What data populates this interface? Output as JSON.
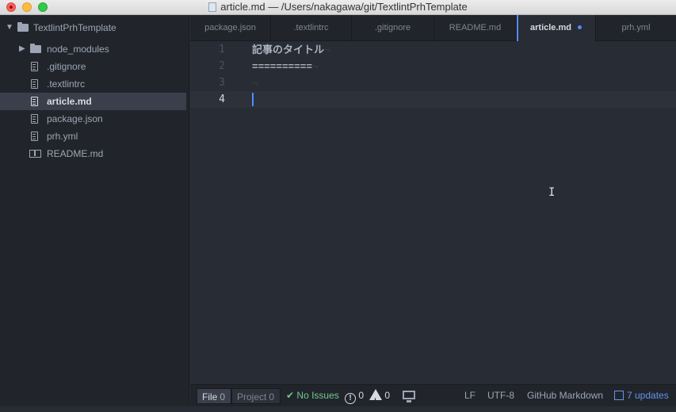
{
  "window": {
    "title": "article.md — /Users/nakagawa/git/TextlintPrhTemplate"
  },
  "tree": {
    "project": "TextlintPrhTemplate",
    "items": [
      {
        "label": "node_modules",
        "kind": "folder",
        "icon": "folder-icon"
      },
      {
        "label": ".gitignore",
        "kind": "file",
        "icon": "file-text-icon"
      },
      {
        "label": ".textlintrc",
        "kind": "file",
        "icon": "file-text-icon"
      },
      {
        "label": "article.md",
        "kind": "file",
        "icon": "file-text-icon",
        "selected": true
      },
      {
        "label": "package.json",
        "kind": "file",
        "icon": "file-text-icon"
      },
      {
        "label": "prh.yml",
        "kind": "file",
        "icon": "file-text-icon"
      },
      {
        "label": "README.md",
        "kind": "file",
        "icon": "book-icon"
      }
    ]
  },
  "tabs": [
    {
      "label": "package.json"
    },
    {
      "label": ".textlintrc"
    },
    {
      "label": ".gitignore"
    },
    {
      "label": "README.md"
    },
    {
      "label": "article.md",
      "active": true,
      "modified": true
    },
    {
      "label": "prh.yml"
    }
  ],
  "editor": {
    "lines": [
      {
        "num": "1",
        "text": "記事のタイトル",
        "eol": "¬"
      },
      {
        "num": "2",
        "text": "==========",
        "eol": "¬"
      },
      {
        "num": "3",
        "text": "",
        "eol": "¬"
      },
      {
        "num": "4",
        "text": "",
        "eol": "",
        "current": true
      }
    ],
    "cursor_glyph": "I"
  },
  "status": {
    "file_label": "File",
    "file_count": "0",
    "project_label": "Project",
    "project_count": "0",
    "lint_status": "No Issues",
    "error_count": "0",
    "warning_count": "0",
    "error_glyph": "!",
    "line_ending": "LF",
    "encoding": "UTF-8",
    "grammar": "GitHub Markdown",
    "updates": "7 updates"
  },
  "colors": {
    "accent": "#568af2",
    "ok": "#73c990",
    "updates": "#6494ed"
  }
}
